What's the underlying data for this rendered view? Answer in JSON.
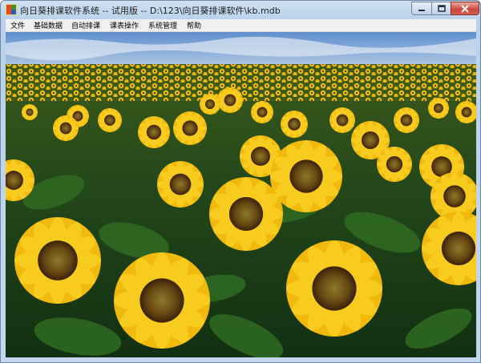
{
  "window": {
    "title": "向日葵排课软件系统 -- 试用版  -- D:\\123\\向日葵排课软件\\kb.mdb"
  },
  "menu": {
    "items": [
      "文件",
      "基础数据",
      "自动排课",
      "课表操作",
      "系统管理",
      "帮助"
    ]
  },
  "background_image": {
    "subject": "sunflower field under blue sky"
  },
  "colors": {
    "sky": "#7fa8d8",
    "petal": "#f3c20f",
    "leaf": "#2f6b22",
    "close_button": "#c9473a"
  }
}
